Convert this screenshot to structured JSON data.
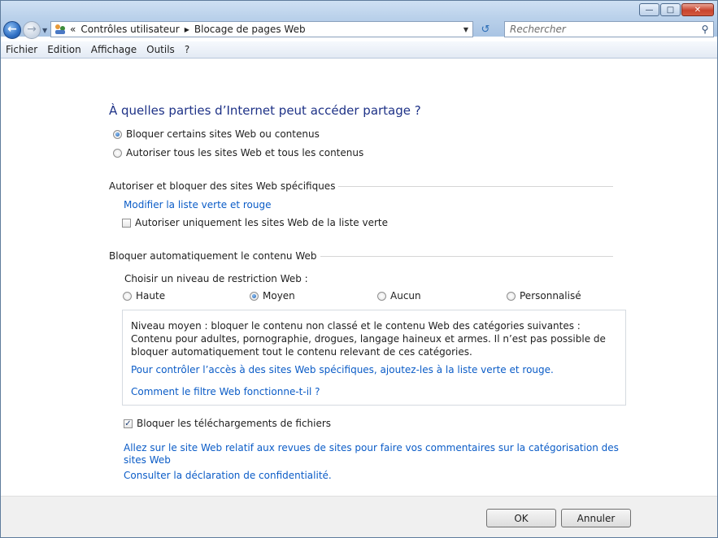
{
  "window": {
    "caption_buttons": {
      "minimize": "minimize-icon",
      "maximize": "maximize-icon",
      "close": "close-icon"
    }
  },
  "address": {
    "prefix": "«",
    "crumbs": [
      "Contrôles utilisateur",
      "Blocage de pages Web"
    ],
    "search_placeholder": "Rechercher"
  },
  "menu": [
    "Fichier",
    "Edition",
    "Affichage",
    "Outils",
    "?"
  ],
  "main": {
    "heading": "À quelles parties d’Internet peut accéder partage ?",
    "options": [
      {
        "label": "Bloquer certains sites Web ou contenus",
        "selected": true
      },
      {
        "label": "Autoriser tous les sites Web et tous les contenus",
        "selected": false
      }
    ],
    "section1": {
      "title": "Autoriser et bloquer des sites Web spécifiques",
      "link": "Modifier la liste verte et rouge",
      "checkbox_label": "Autoriser uniquement les sites Web de la liste verte",
      "checkbox_checked": false
    },
    "section2": {
      "title": "Bloquer automatiquement le contenu Web",
      "level_prompt": "Choisir un niveau de restriction Web :",
      "levels": [
        {
          "label": "Haute",
          "selected": false
        },
        {
          "label": "Moyen",
          "selected": true
        },
        {
          "label": "Aucun",
          "selected": false
        },
        {
          "label": "Personnalisé",
          "selected": false
        }
      ],
      "description": "Niveau moyen : bloquer le contenu non classé et le contenu Web des catégories suivantes : Contenu pour adultes, pornographie, drogues, langage haineux et armes. Il n’est pas possible de bloquer automatiquement tout le contenu relevant de ces catégories.",
      "info_link": "Pour contrôler l’accès à des sites Web spécifiques, ajoutez-les à la liste verte et rouge.",
      "how_link": "Comment le filtre Web fonctionne-t-il ?"
    },
    "download_block": {
      "label": "Bloquer les téléchargements de fichiers",
      "checked": true
    },
    "review_link": "Allez sur le site Web relatif aux revues de sites pour faire vos commentaires sur la catégorisation des sites Web",
    "privacy_link": "Consulter la déclaration de confidentialité."
  },
  "footer": {
    "ok": "OK",
    "cancel": "Annuler"
  },
  "colors": {
    "link": "#0b5cc7",
    "heading": "#1e3287",
    "accent_blue": "#2f6fc4"
  }
}
